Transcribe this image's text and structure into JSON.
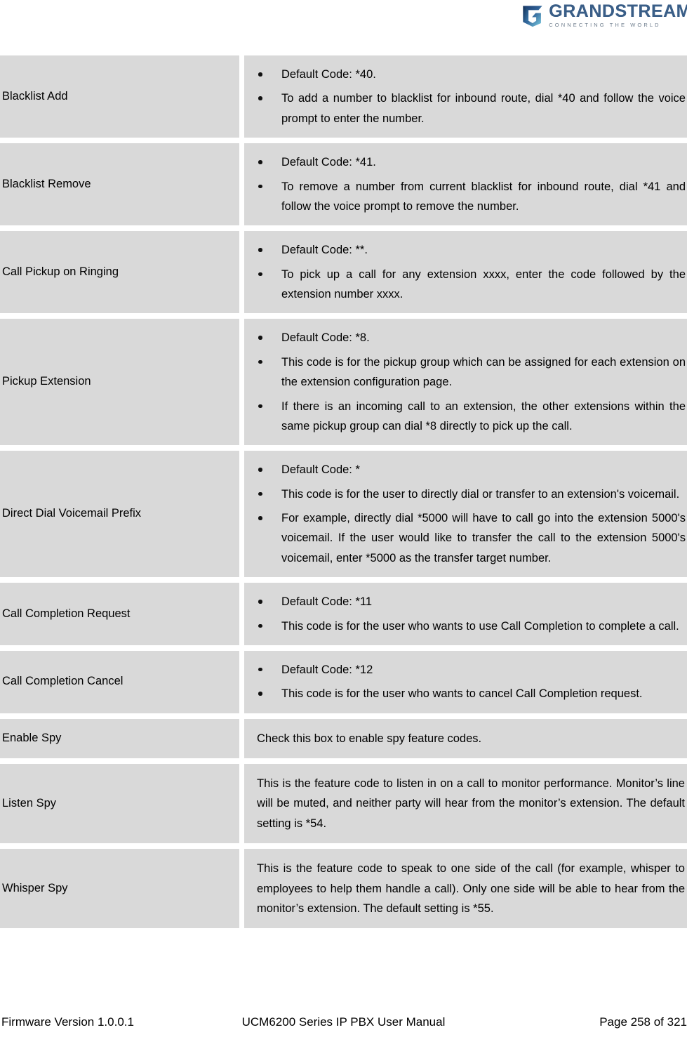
{
  "header": {
    "logo_word": "GRANDSTREAM",
    "logo_tagline": "CONNECTING THE WORLD",
    "logo_icon": "grandstream-swoosh-logo"
  },
  "table": {
    "rows": [
      {
        "name": "Blacklist Add",
        "type": "bullets",
        "items": [
          "Default Code: *40.",
          "To add a number to blacklist for inbound route, dial *40 and follow the voice prompt to enter the number."
        ]
      },
      {
        "name": "Blacklist Remove",
        "type": "bullets",
        "items": [
          "Default Code: *41.",
          "To remove a number from current blacklist for inbound route, dial *41 and follow the voice prompt to remove the number."
        ]
      },
      {
        "name": "Call Pickup on Ringing",
        "type": "bullets",
        "items": [
          "Default Code: **.",
          "To pick up a call for any extension xxxx, enter the code followed by the extension number xxxx."
        ]
      },
      {
        "name": "Pickup Extension",
        "type": "bullets",
        "items": [
          "Default Code: *8.",
          "This code is for the pickup group which can be assigned for each extension on the extension configuration page.",
          "If there is an incoming call to an extension, the other extensions within the same pickup group can dial *8 directly to pick up the call."
        ]
      },
      {
        "name": "Direct Dial Voicemail Prefix",
        "type": "bullets",
        "items": [
          "Default Code: *",
          "This code is for the user to directly dial or transfer to an extension's voicemail.",
          "For example, directly dial *5000 will have to call go into the extension 5000's voicemail. If the user would like to transfer the call to the extension 5000's voicemail, enter *5000 as the transfer target number."
        ]
      },
      {
        "name": "Call Completion Request",
        "type": "bullets",
        "items": [
          "Default Code: *11",
          "This code is for the user who wants to use Call Completion to complete a call."
        ]
      },
      {
        "name": "Call Completion Cancel",
        "type": "bullets",
        "items": [
          "Default Code: *12",
          "This code is for the user who wants to cancel Call Completion request."
        ]
      },
      {
        "name": "Enable Spy",
        "type": "text",
        "text": "Check this box to enable spy feature codes."
      },
      {
        "name": "Listen Spy",
        "type": "text",
        "text": "This is the feature code to listen in on a call to monitor performance. Monitor’s line will be muted, and neither party will hear from the monitor’s extension. The default setting is *54."
      },
      {
        "name": "Whisper Spy",
        "type": "text",
        "text": "This is the feature code to speak to one side of the call (for example, whisper to employees to help them handle a call). Only one side will be able to hear from the monitor’s extension. The default setting is *55."
      }
    ]
  },
  "footer": {
    "left": "Firmware Version 1.0.0.1",
    "center": "UCM6200 Series IP PBX User Manual",
    "right": "Page 258 of 321"
  }
}
